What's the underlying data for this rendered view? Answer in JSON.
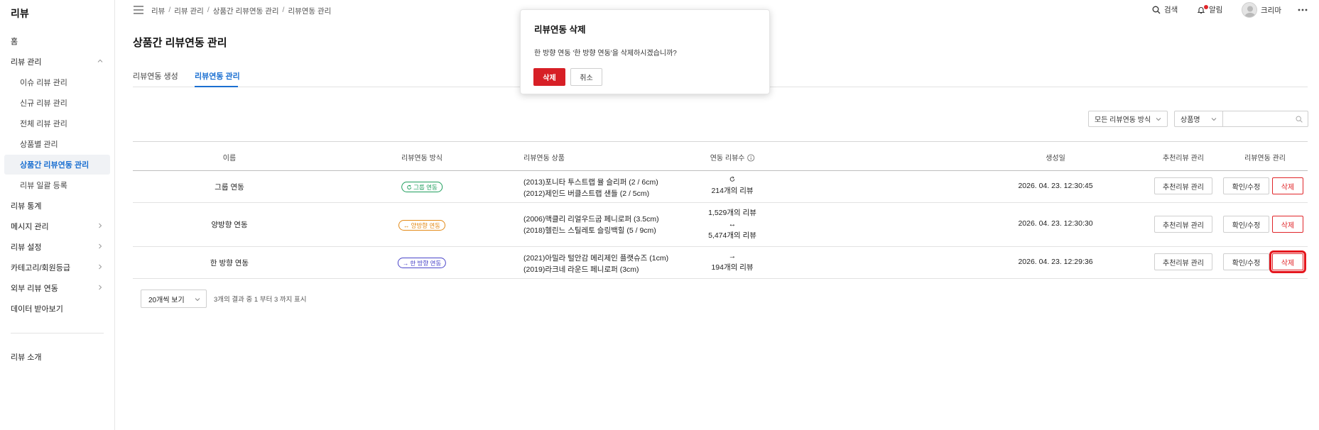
{
  "sidebar": {
    "brand": "리뷰",
    "items": [
      {
        "label": "홈"
      },
      {
        "label": "리뷰 관리"
      },
      {
        "label": "이슈 리뷰 관리"
      },
      {
        "label": "신규 리뷰 관리"
      },
      {
        "label": "전체 리뷰 관리"
      },
      {
        "label": "상품별 관리"
      },
      {
        "label": "상품간 리뷰연동 관리"
      },
      {
        "label": "리뷰 일괄 등록"
      },
      {
        "label": "리뷰 통계"
      },
      {
        "label": "메시지 관리"
      },
      {
        "label": "리뷰 설정"
      },
      {
        "label": "카테고리/회원등급"
      },
      {
        "label": "외부 리뷰 연동"
      },
      {
        "label": "데이터 받아보기"
      },
      {
        "label": "리뷰 소개"
      }
    ]
  },
  "breadcrumb": [
    "리뷰",
    "리뷰 관리",
    "상품간 리뷰연동 관리",
    "리뷰연동 관리"
  ],
  "topbar": {
    "search": "검색",
    "alerts": "알림",
    "user": "크리마"
  },
  "page": {
    "title": "상품간 리뷰연동 관리"
  },
  "tabs": [
    {
      "label": "리뷰연동 생성"
    },
    {
      "label": "리뷰연동 관리"
    }
  ],
  "filters": {
    "method_select": "모든 리뷰연동 방식",
    "field_select": "상품명",
    "search_value": ""
  },
  "table": {
    "headers": [
      "이름",
      "리뷰연동 방식",
      "리뷰연동 상품",
      "연동 리뷰수",
      "생성일",
      "추천리뷰 관리",
      "리뷰연동 관리"
    ],
    "rows": [
      {
        "name": "그룹 연동",
        "method": "그룹 연동",
        "product1": "(2013)포니타 투스트랩 뮬 슬리퍼 (2 / 6cm)",
        "product2": "(2012)제인드 버클스트랩 샌들 (2 / 5cm)",
        "count1": "214개의 리뷰",
        "date": "2026. 04. 23. 12:30:45",
        "btn_reco": "추천리뷰 관리",
        "btn_edit": "확인/수정",
        "btn_delete": "삭제"
      },
      {
        "name": "양방향 연동",
        "method": "양방향 연동",
        "product1": "(2006)맥클리 리얼우드굽 페니로퍼 (3.5cm)",
        "product2": "(2018)헬린느 스틸레토 슬링백힐 (5 / 9cm)",
        "count1": "1,529개의 리뷰",
        "count2": "5,474개의 리뷰",
        "date": "2026. 04. 23. 12:30:30",
        "btn_reco": "추천리뷰 관리",
        "btn_edit": "확인/수정",
        "btn_delete": "삭제"
      },
      {
        "name": "한 방향 연동",
        "method": "한 방향 연동",
        "product1": "(2021)아밀라 털안감 메리제인 플랫슈즈 (1cm)",
        "product2": "(2019)라크네 라운드 페니로퍼 (3cm)",
        "count1": "194개의 리뷰",
        "date": "2026. 04. 23. 12:29:36",
        "btn_reco": "추천리뷰 관리",
        "btn_edit": "확인/수정",
        "btn_delete": "삭제"
      }
    ]
  },
  "pager": {
    "per_page": "20개씩 보기",
    "summary": "3개의 결과 중 1 부터 3 까지 표시"
  },
  "modal": {
    "title": "리뷰연동 삭제",
    "message": "한 방향 연동 '한 방향 연동'을 삭제하시겠습니까?",
    "confirm": "삭제",
    "cancel": "취소"
  },
  "colors": {
    "accent": "#1a6fd1",
    "danger": "#d71f26",
    "group": "#1f9e5d",
    "bi": "#e38a17",
    "one": "#4a45c9"
  }
}
